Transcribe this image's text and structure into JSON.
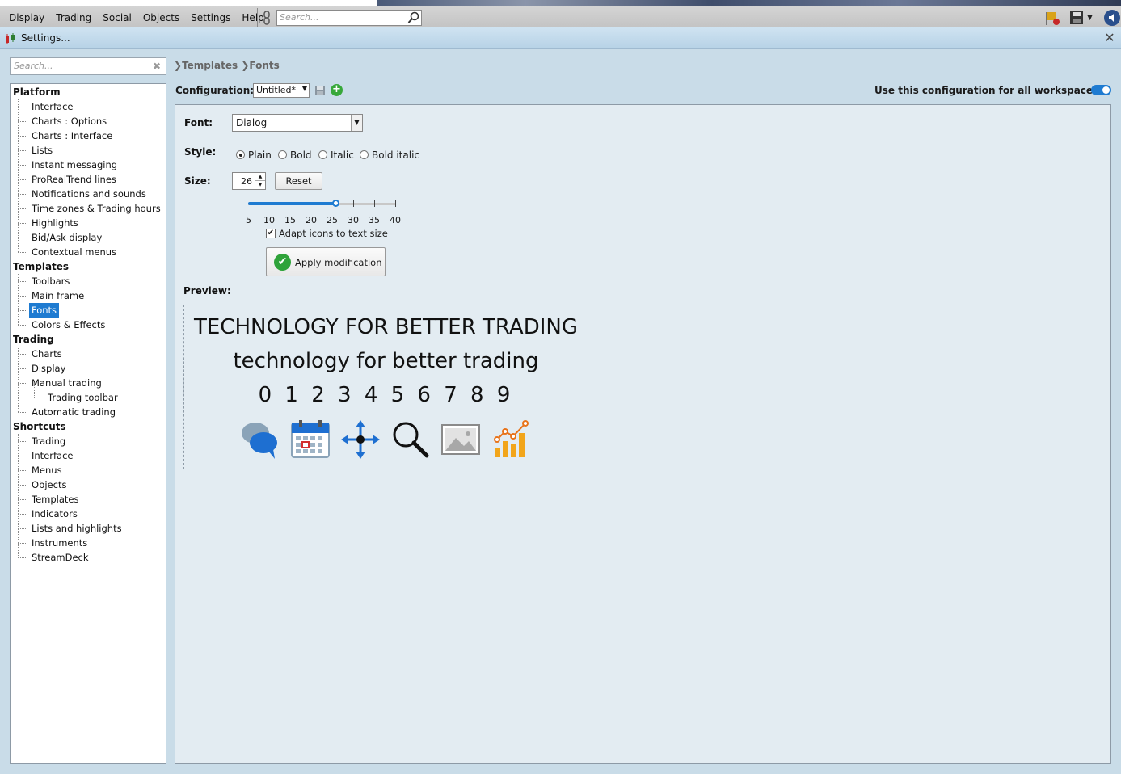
{
  "menubar": {
    "items": [
      "Display",
      "Trading",
      "Social",
      "Objects",
      "Settings",
      "Help"
    ],
    "search_placeholder": "Search..."
  },
  "window": {
    "title": "Settings...",
    "close_glyph": "✕"
  },
  "sidebar": {
    "search_placeholder": "Search...",
    "categories": [
      {
        "label": "Platform",
        "items": [
          {
            "label": "Interface"
          },
          {
            "label": "Charts : Options"
          },
          {
            "label": "Charts : Interface"
          },
          {
            "label": "Lists"
          },
          {
            "label": "Instant messaging"
          },
          {
            "label": "ProRealTrend lines"
          },
          {
            "label": "Notifications and sounds"
          },
          {
            "label": "Time zones & Trading hours"
          },
          {
            "label": "Highlights"
          },
          {
            "label": "Bid/Ask display"
          },
          {
            "label": "Contextual menus"
          }
        ]
      },
      {
        "label": "Templates",
        "items": [
          {
            "label": "Toolbars"
          },
          {
            "label": "Main frame"
          },
          {
            "label": "Fonts",
            "selected": true
          },
          {
            "label": "Colors & Effects"
          }
        ]
      },
      {
        "label": "Trading",
        "items": [
          {
            "label": "Charts"
          },
          {
            "label": "Display"
          },
          {
            "label": "Manual trading"
          },
          {
            "label": "Trading toolbar",
            "sub": true
          },
          {
            "label": "Automatic trading"
          }
        ]
      },
      {
        "label": "Shortcuts",
        "items": [
          {
            "label": "Trading"
          },
          {
            "label": "Interface"
          },
          {
            "label": "Menus"
          },
          {
            "label": "Objects"
          },
          {
            "label": "Templates"
          },
          {
            "label": "Indicators"
          },
          {
            "label": "Lists and highlights"
          },
          {
            "label": "Instruments"
          },
          {
            "label": "StreamDeck"
          }
        ]
      }
    ]
  },
  "breadcrumb": [
    "Templates",
    "Fonts"
  ],
  "config": {
    "label": "Configuration:",
    "value": "Untitled*",
    "all_workspaces_label": "Use this configuration for all workspaces",
    "all_workspaces_on": true
  },
  "font_settings": {
    "font_label": "Font:",
    "font_value": "Dialog",
    "style_label": "Style:",
    "styles": [
      "Plain",
      "Bold",
      "Italic",
      "Bold italic"
    ],
    "selected_style": "Plain",
    "size_label": "Size:",
    "size_value": "26",
    "reset_label": "Reset",
    "slider": {
      "min": 5,
      "max": 40,
      "value": 26,
      "ticks": [
        "5",
        "10",
        "15",
        "20",
        "25",
        "30",
        "35",
        "40"
      ]
    },
    "adapt_icons_label": "Adapt icons to text size",
    "adapt_icons_checked": true,
    "apply_label": "Apply modification"
  },
  "preview": {
    "label": "Preview:",
    "uppercase": "TECHNOLOGY FOR BETTER TRADING",
    "lowercase": "technology for better trading",
    "digits": "0 1 2 3 4 5 6 7 8 9",
    "icons": [
      "chat-bubbles-icon",
      "calendar-icon",
      "move-arrows-icon",
      "magnifier-icon",
      "image-icon",
      "bar-chart-icon"
    ]
  },
  "colors": {
    "accent": "#1e7bd1",
    "confirm_green": "#2fa33a"
  }
}
